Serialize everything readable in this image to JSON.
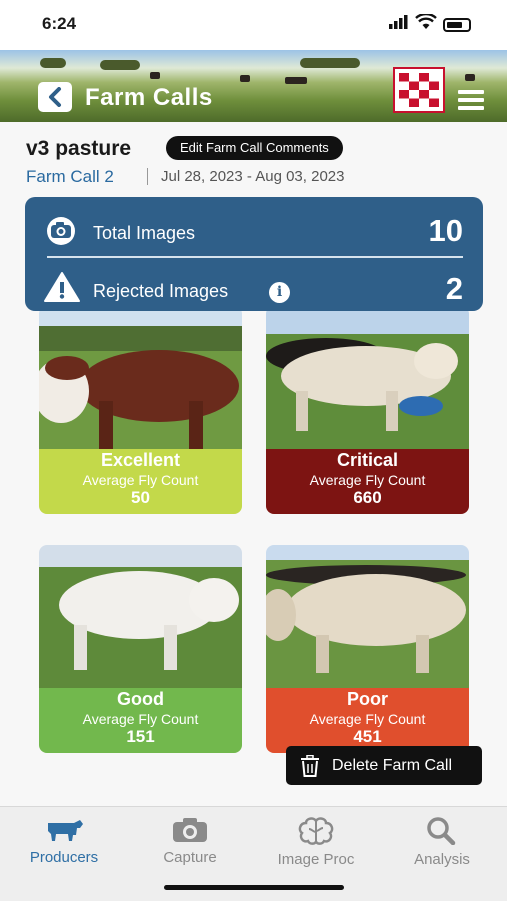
{
  "status_bar": {
    "time": "6:24"
  },
  "header": {
    "title": "Farm Calls"
  },
  "pasture": {
    "name": "v3 pasture",
    "edit_button": "Edit Farm Call Comments",
    "farm_call_link": "Farm Call 2",
    "date_range": "Jul 28, 2023 - Aug 03, 2023"
  },
  "summary": {
    "total_label": "Total Images",
    "total_value": "10",
    "rejected_label": "Rejected Images",
    "rejected_value": "2"
  },
  "cards": [
    {
      "rating": "Excellent",
      "subtitle": "Average Fly Count",
      "count": "50",
      "color": "#c3d94a"
    },
    {
      "rating": "Critical",
      "subtitle": "Average Fly Count",
      "count": "660",
      "color": "#7d1412"
    },
    {
      "rating": "Good",
      "subtitle": "Average Fly Count",
      "count": "151",
      "color": "#72b84d"
    },
    {
      "rating": "Poor",
      "subtitle": "Average Fly Count",
      "count": "451",
      "color": "#e04f2d"
    }
  ],
  "delete_button": "Delete Farm Call",
  "tabs": [
    {
      "label": "Producers",
      "icon": "cow-icon",
      "active": true
    },
    {
      "label": "Capture",
      "icon": "camera-icon",
      "active": false
    },
    {
      "label": "Image Proc",
      "icon": "brain-icon",
      "active": false
    },
    {
      "label": "Analysis",
      "icon": "magnifier-icon",
      "active": false
    }
  ],
  "colors": {
    "accent": "#2f5f89",
    "link": "#2a6aa0",
    "tab_active": "#2f6fa5"
  }
}
